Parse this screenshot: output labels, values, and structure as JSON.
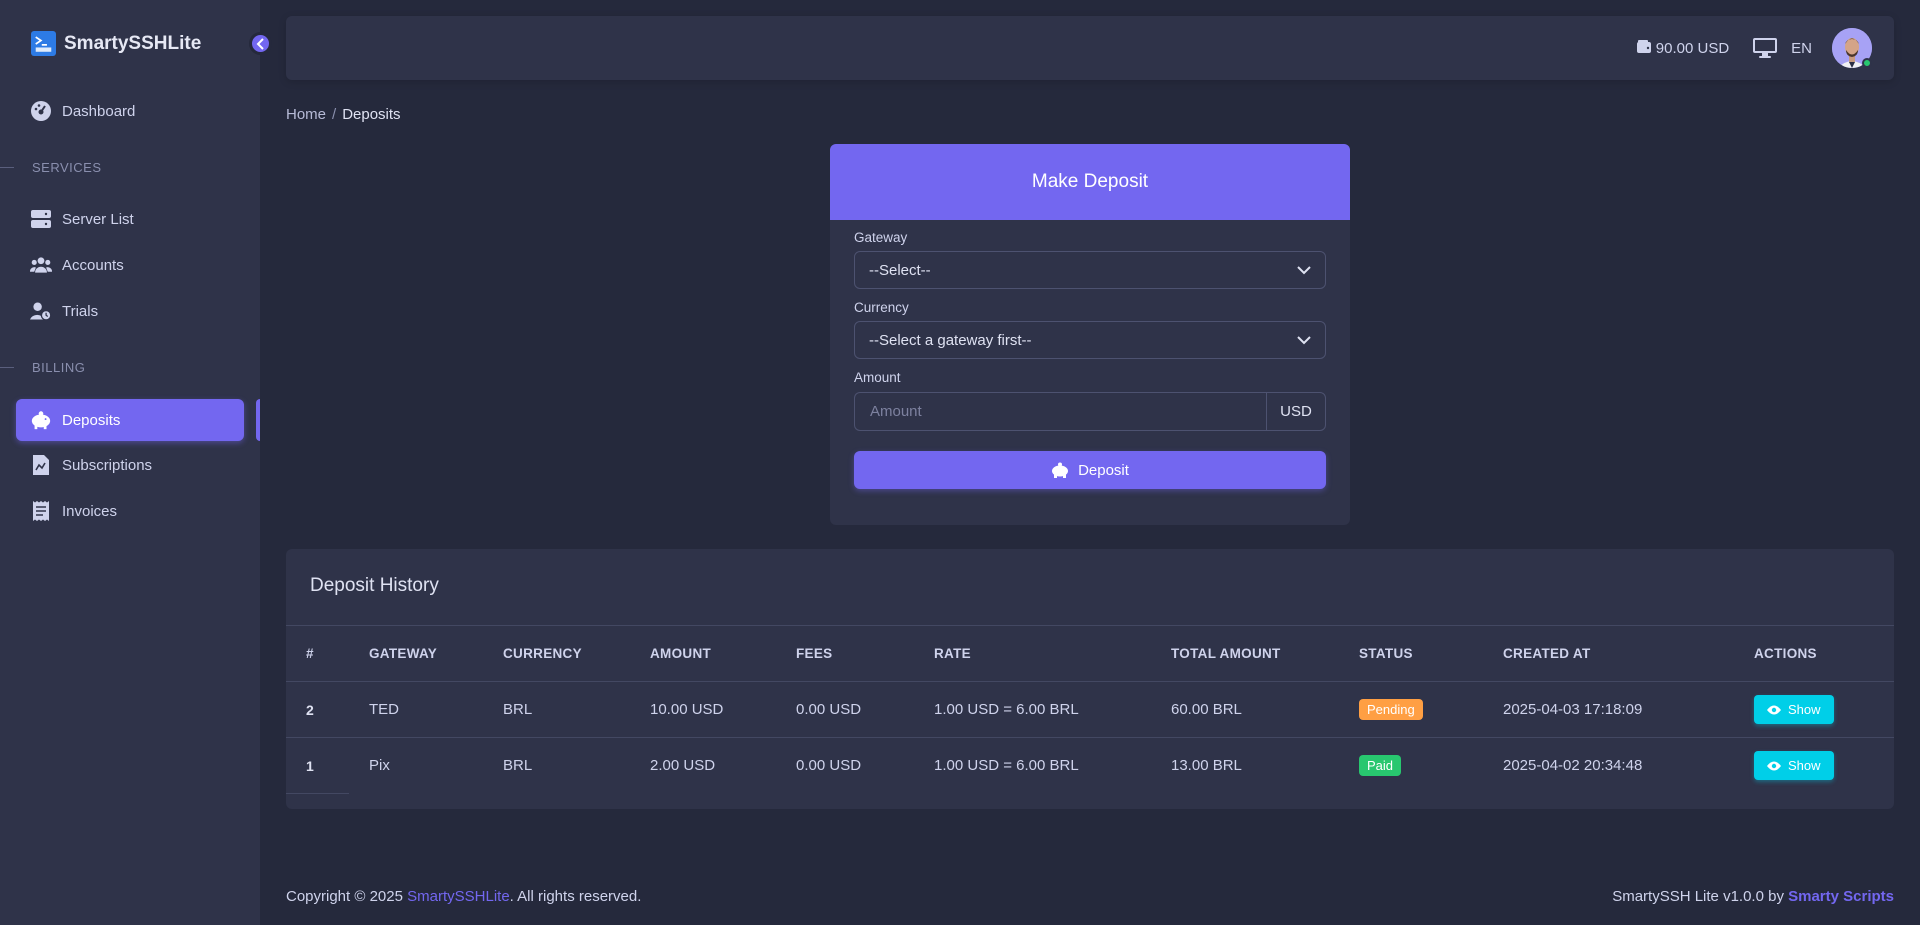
{
  "brand": {
    "name": "SmartySSHLite",
    "logo_text": ">_\nSSH"
  },
  "sidebar": {
    "dashboard": "Dashboard",
    "section_services": "SERVICES",
    "server_list": "Server List",
    "accounts": "Accounts",
    "trials": "Trials",
    "section_billing": "BILLING",
    "deposits": "Deposits",
    "subscriptions": "Subscriptions",
    "invoices": "Invoices"
  },
  "topbar": {
    "balance": "90.00 USD",
    "language": "EN"
  },
  "breadcrumb": {
    "home": "Home",
    "sep": "/",
    "current": "Deposits"
  },
  "deposit_form": {
    "title": "Make Deposit",
    "gateway_label": "Gateway",
    "gateway_value": "--Select--",
    "currency_label": "Currency",
    "currency_value": "--Select a gateway first--",
    "amount_label": "Amount",
    "amount_placeholder": "Amount",
    "amount_addon": "USD",
    "submit_label": "Deposit"
  },
  "history": {
    "title": "Deposit History",
    "columns": [
      "#",
      "GATEWAY",
      "CURRENCY",
      "AMOUNT",
      "FEES",
      "RATE",
      "TOTAL AMOUNT",
      "STATUS",
      "CREATED AT",
      "ACTIONS"
    ],
    "rows": [
      {
        "id": "2",
        "gateway": "TED",
        "currency": "BRL",
        "amount": "10.00 USD",
        "fees": "0.00 USD",
        "rate": "1.00 USD = 6.00 BRL",
        "total": "60.00 BRL",
        "status": "Pending",
        "created": "2025-04-03 17:18:09",
        "action": "Show"
      },
      {
        "id": "1",
        "gateway": "Pix",
        "currency": "BRL",
        "amount": "2.00 USD",
        "fees": "0.00 USD",
        "rate": "1.00 USD = 6.00 BRL",
        "total": "13.00 BRL",
        "status": "Paid",
        "created": "2025-04-02 20:34:48",
        "action": "Show"
      }
    ]
  },
  "footer": {
    "copyright_prefix": "Copyright © 2025 ",
    "copyright_link": "SmartySSHLite",
    "copyright_suffix": ". All rights reserved.",
    "version_prefix": "SmartySSH Lite v1.0.0 by ",
    "version_link": "Smarty Scripts"
  },
  "colors": {
    "primary": "#7367f0",
    "pending": "#ff9f43",
    "paid": "#28c76f",
    "info": "#00cfe8",
    "bg": "#25293c",
    "surface": "#2f3349"
  },
  "icons": [
    "dashboard-icon",
    "server-icon",
    "users-icon",
    "user-clock-icon",
    "piggy-bank-icon",
    "subscription-icon",
    "receipt-icon",
    "wallet-icon",
    "monitor-icon",
    "chevron-down-icon",
    "chevron-left-icon",
    "eye-icon"
  ]
}
